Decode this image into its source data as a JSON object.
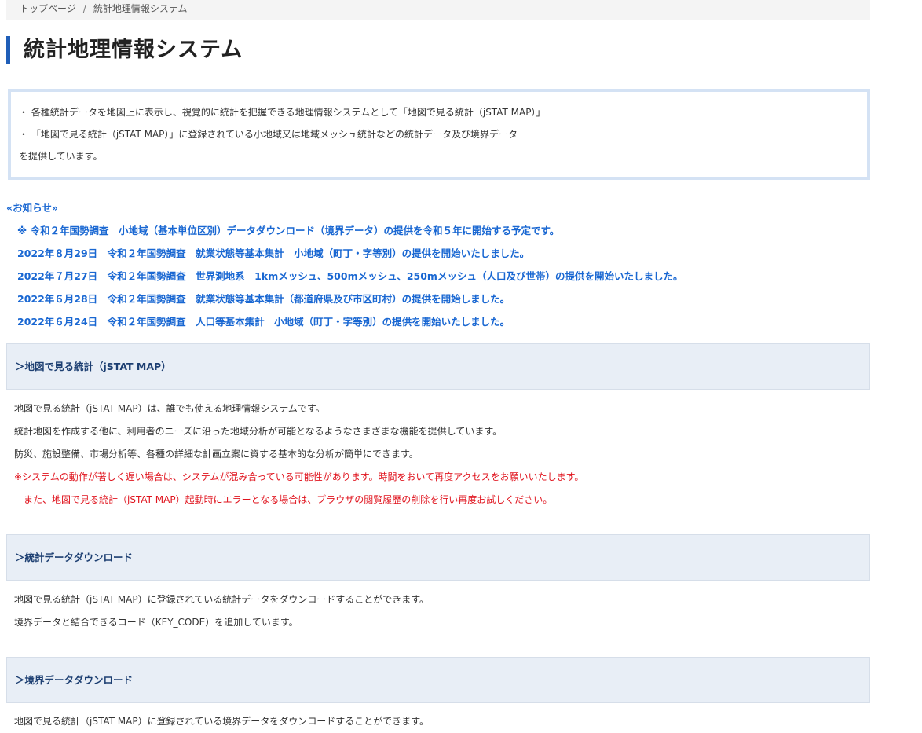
{
  "breadcrumb": {
    "home": "トップページ",
    "separator": "/",
    "current": "統計地理情報システム"
  },
  "page_title": "統計地理情報システム",
  "intro": {
    "lines": [
      "・ 各種統計データを地図上に表示し、視覚的に統計を把握できる地理情報システムとして「地図で見る統計（jSTAT MAP）」",
      "・ 「地図で見る統計（jSTAT MAP）」に登録されている小地域又は地域メッシュ統計などの統計データ及び境界データ",
      "を提供しています。"
    ]
  },
  "notices": {
    "heading": "«お知らせ»",
    "items": [
      "※ 令和２年国勢調査　小地域（基本単位区別）データダウンロード（境界データ）の提供を令和５年に開始する予定です。",
      "2022年８月29日　令和２年国勢調査　就業状態等基本集計　小地域（町丁・字等別）の提供を開始いたしました。",
      "2022年７月27日　令和２年国勢調査　世界測地系　1kmメッシュ、500mメッシュ、250mメッシュ（人口及び世帯）の提供を開始いたしました。",
      "2022年６月28日　令和２年国勢調査　就業状態等基本集計（都道府県及び市区町村）の提供を開始しました。",
      "2022年６月24日　令和２年国勢調査　人口等基本集計　小地域（町丁・字等別）の提供を開始いたしました。"
    ]
  },
  "sections": {
    "jstat": {
      "heading": "＞地図で見る統計（jSTAT MAP）",
      "lines": [
        "地図で見る統計（jSTAT MAP）は、誰でも使える地理情報システムです。",
        "統計地図を作成する他に、利用者のニーズに沿った地域分析が可能となるようなさまざまな機能を提供しています。",
        "防災、施設整備、市場分析等、各種の詳細な計画立案に資する基本的な分析が簡単にできます。"
      ],
      "warnings": [
        "※システムの動作が著しく遅い場合は、システムが混み合っている可能性があります。時間をおいて再度アクセスをお願いいたします。",
        "また、地図で見る統計（jSTAT MAP）起動時にエラーとなる場合は、ブラウザの閲覧履歴の削除を行い再度お試しください。"
      ]
    },
    "stat_download": {
      "heading": "＞統計データダウンロード",
      "lines": [
        "地図で見る統計（jSTAT MAP）に登録されている統計データをダウンロードすることができます。",
        "境界データと結合できるコード（KEY_CODE）を追加しています。"
      ]
    },
    "boundary_download": {
      "heading": "＞境界データダウンロード",
      "lines": [
        "地図で見る統計（jSTAT MAP）に登録されている境界データをダウンロードすることができます。"
      ]
    }
  },
  "colors": {
    "accent": "#1f5eb8",
    "link": "#1967d2",
    "warning": "#e0141e",
    "section_bg": "#e8eef6",
    "intro_border": "#d4e2f4"
  }
}
